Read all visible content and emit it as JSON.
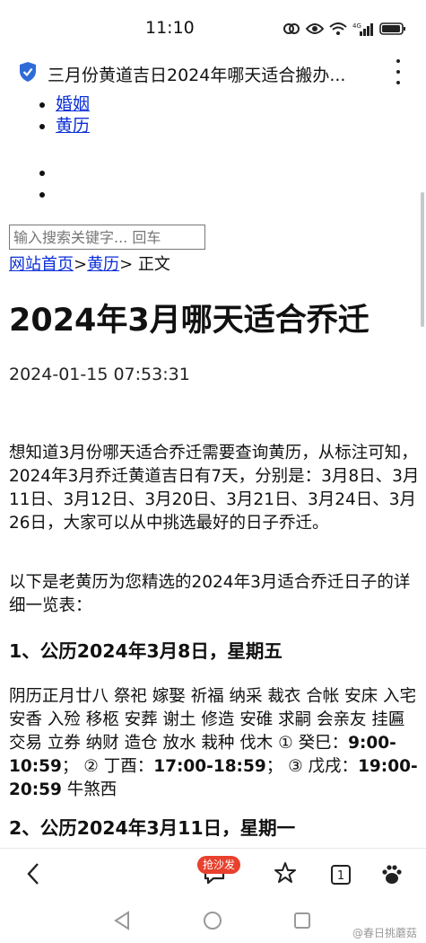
{
  "status_bar": {
    "time": "11:10",
    "network_label": "4G"
  },
  "address_bar": {
    "title": "三月份黄道吉日2024年哪天适合搬办..."
  },
  "nav_list": {
    "items": [
      "婚姻",
      "黄历"
    ]
  },
  "search": {
    "placeholder": "输入搜索关键字... 回车"
  },
  "breadcrumb": {
    "home": "网站首页",
    "sep1": ">",
    "section": "黄历",
    "sep2": "> 正文"
  },
  "article": {
    "title": "2024年3月哪天适合乔迁",
    "date": "2024-01-15 07:53:31",
    "intro": "想知道3月份哪天适合乔迁需要查询黄历，从标注可知，2024年3月乔迁黄道吉日有7天，分别是：3月8日、3月11日、3月12日、3月20日、3月21日、3月24日、3月26日，大家可以从中挑选最好的日子乔迁。",
    "lead": "以下是老黄历为您精选的2024年3月适合乔迁日子的详细一览表：",
    "section1_heading": "1、公历2024年3月8日，星期五",
    "section1_body_a": "阴历正月廿八 祭祀 嫁娶 祈福 纳采 裁衣 合帐 安床 入宅 安香 入殓 移柩 安葬 谢土 修造 安碓 求嗣 会亲友 挂匾 交易 立券 纳财 造仓 放水 栽种 伐木 ① 癸巳：",
    "section1_time1": "9:00-10:59",
    "section1_body_b": "； ② 丁酉：",
    "section1_time2": "17:00-18:59",
    "section1_body_c": "； ③ 戊戌：",
    "section1_time3": "19:00-20:59",
    "section1_body_d": " 牛煞西",
    "section2_heading": "2、公历2024年3月11日，星期一"
  },
  "toolbar": {
    "badge": "抢沙发",
    "tabs_count": "1"
  },
  "watermark": "@春日挑蘑菇"
}
